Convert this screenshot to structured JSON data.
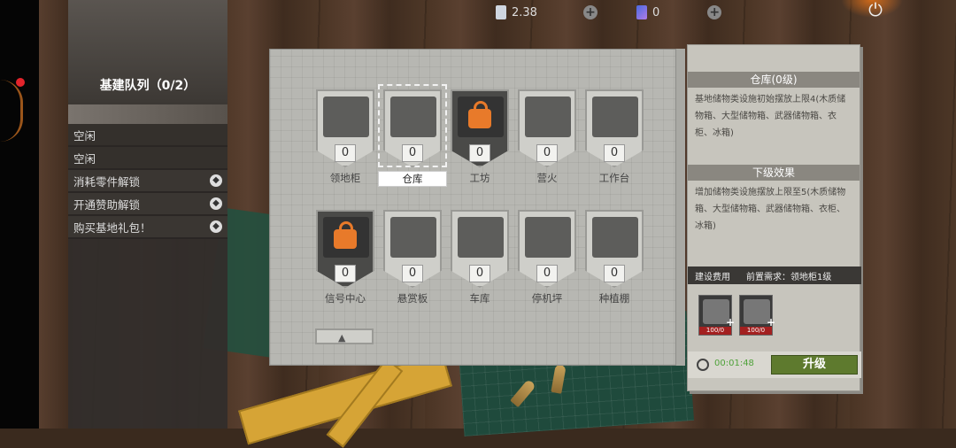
{
  "topbar": {
    "currency1_value": "2.38",
    "currency2_value": "0",
    "add_icon": "plus-icon",
    "power_icon": "power-icon"
  },
  "queue": {
    "title": "基建队列（0/2）",
    "rows": [
      {
        "label": "空闲",
        "locked": false
      },
      {
        "label": "空闲",
        "locked": false
      },
      {
        "label": "消耗零件解锁",
        "locked": true
      },
      {
        "label": "开通赞助解锁",
        "locked": true
      },
      {
        "label": "购买基地礼包！",
        "locked": true
      }
    ]
  },
  "buildings": [
    {
      "name": "领地柜",
      "count": "0",
      "locked": false,
      "selected": false
    },
    {
      "name": "仓库",
      "count": "0",
      "locked": false,
      "selected": true
    },
    {
      "name": "工坊",
      "count": "0",
      "locked": true,
      "selected": false
    },
    {
      "name": "营火",
      "count": "0",
      "locked": false,
      "selected": false
    },
    {
      "name": "工作台",
      "count": "0",
      "locked": false,
      "selected": false
    },
    {
      "name": "信号中心",
      "count": "0",
      "locked": true,
      "selected": false
    },
    {
      "name": "悬赏板",
      "count": "0",
      "locked": false,
      "selected": false
    },
    {
      "name": "车库",
      "count": "0",
      "locked": false,
      "selected": false
    },
    {
      "name": "停机坪",
      "count": "0",
      "locked": false,
      "selected": false
    },
    {
      "name": "种植棚",
      "count": "0",
      "locked": false,
      "selected": false
    }
  ],
  "info": {
    "title": "仓库(0级)",
    "description": "基地储物类设施初始摆放上限4(木质储物箱、大型储物箱、武器储物箱、衣柜、冰箱)",
    "next_title": "下级效果",
    "next_description": "增加储物类设施摆放上限至5(木质储物箱、大型储物箱、武器储物箱、衣柜、冰箱)",
    "cost_label": "建设费用",
    "prereq_label": "前置需求：领地柜1级",
    "resources": [
      {
        "qty": "100/0"
      },
      {
        "qty": "100/0"
      }
    ],
    "timer": "00:01:48",
    "upgrade_label": "升级"
  },
  "colors": {
    "accent_green": "#5e7a2e",
    "lock_orange": "#e87a2a",
    "timer_green": "#4fa23a"
  }
}
